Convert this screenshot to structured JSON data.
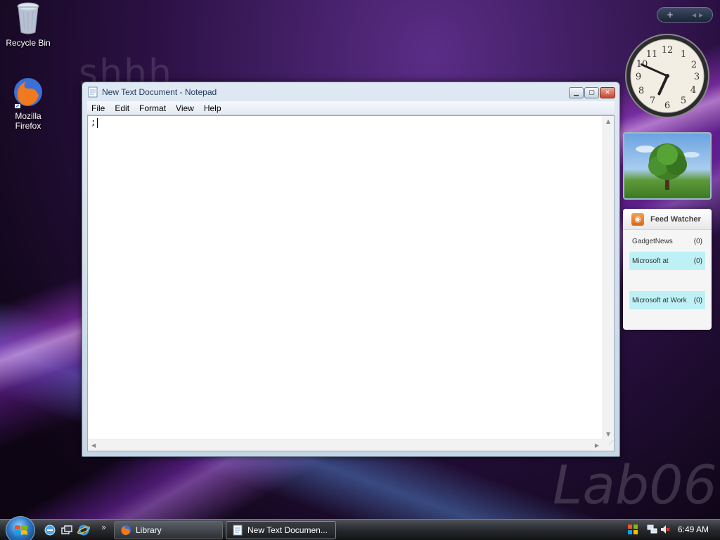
{
  "desktop": {
    "watermark_top": "shhh",
    "watermark_bottom": "Lab06",
    "icons": [
      {
        "label": "Recycle Bin",
        "icon": "recycle-bin-icon"
      },
      {
        "label": "Mozilla Firefox",
        "icon": "firefox-icon"
      }
    ]
  },
  "notepad": {
    "title": "New Text Document - Notepad",
    "menu": [
      "File",
      "Edit",
      "Format",
      "View",
      "Help"
    ],
    "content": ";"
  },
  "sidebar": {
    "add_label": "+",
    "nav_label": "◂ ▸",
    "clock": {
      "hour": 6,
      "minute": 49
    },
    "photo": {
      "icon": "tree-photo"
    },
    "feed": {
      "title": "Feed Watcher",
      "rows": [
        {
          "name": "GadgetNews",
          "count": "(0)",
          "highlight": false
        },
        {
          "name": "Microsoft at",
          "count": "(0)",
          "highlight": true
        },
        {
          "name": "Microsoft at Work",
          "count": "(0)",
          "highlight": true
        }
      ]
    }
  },
  "taskbar": {
    "chevron": "»",
    "buttons": [
      {
        "label": "Library",
        "icon": "firefox-icon",
        "active": false
      },
      {
        "label": "New Text Documen...",
        "icon": "notepad-icon",
        "active": true
      }
    ],
    "time": "6:49 AM"
  }
}
